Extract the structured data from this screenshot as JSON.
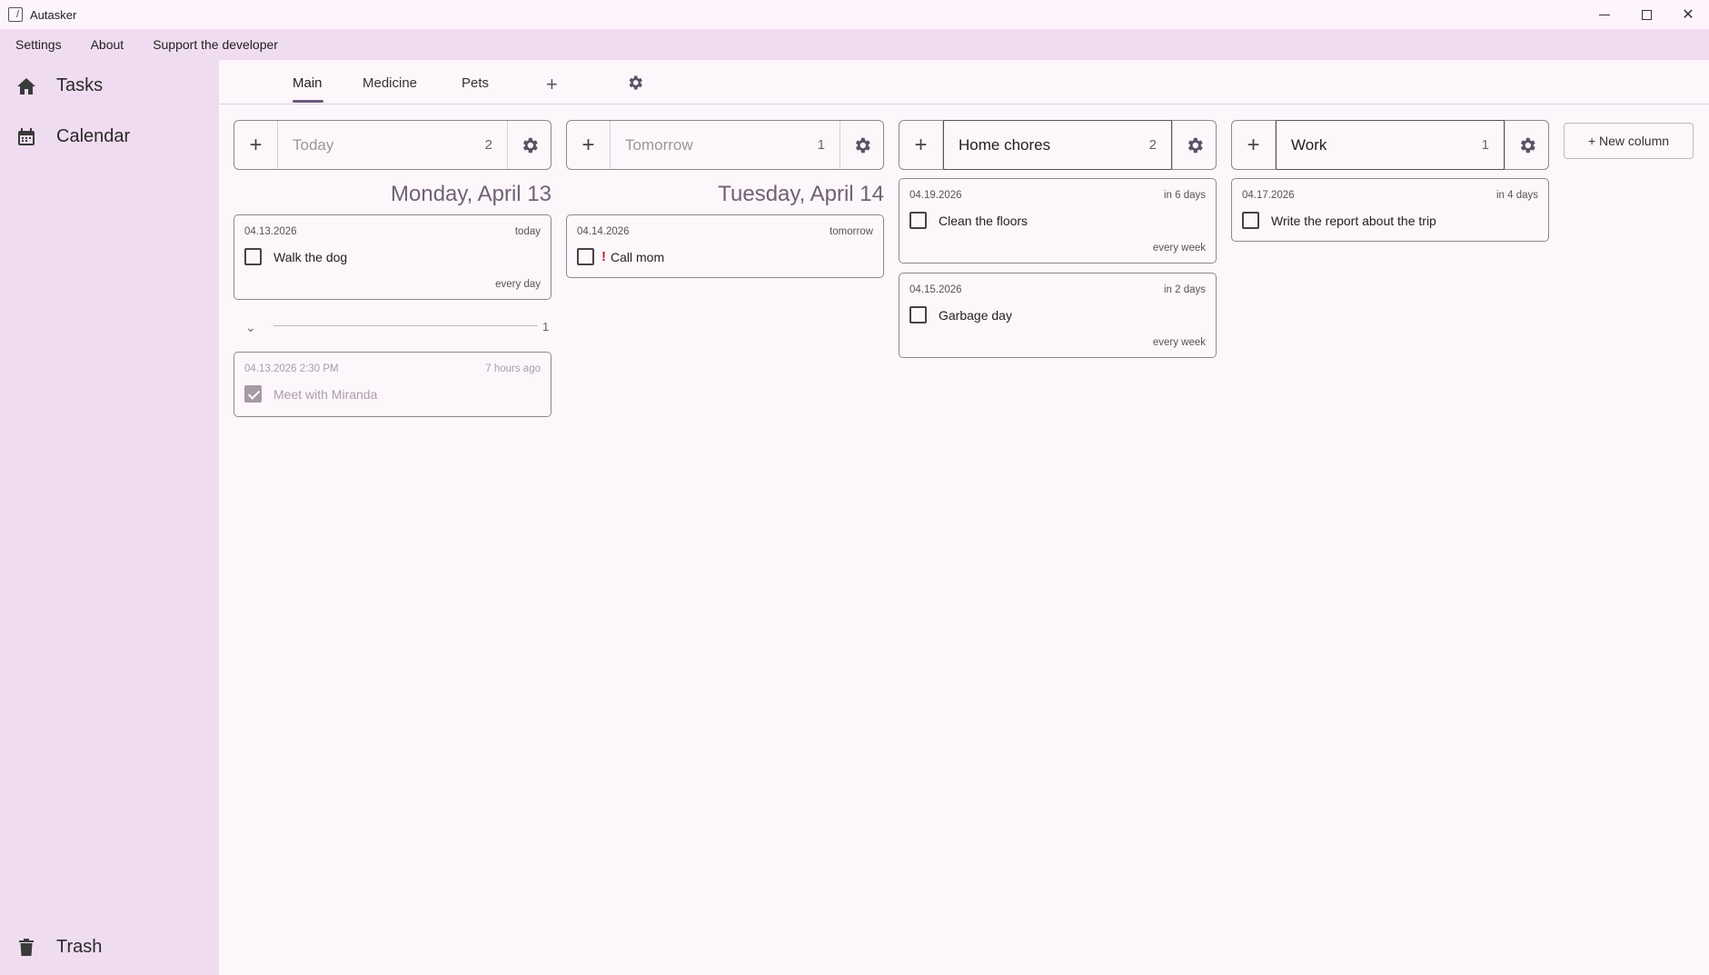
{
  "window": {
    "title": "Autasker"
  },
  "menu": {
    "settings": "Settings",
    "about": "About",
    "support": "Support the developer"
  },
  "sidebar": {
    "tasks": "Tasks",
    "calendar": "Calendar",
    "trash": "Trash"
  },
  "tabs": {
    "main": "Main",
    "medicine": "Medicine",
    "pets": "Pets"
  },
  "columns": {
    "today": {
      "name": "Today",
      "count": "2",
      "heading": "Monday, April 13"
    },
    "tomorrow": {
      "name": "Tomorrow",
      "count": "1",
      "heading": "Tuesday, April 14"
    },
    "home": {
      "name": "Home chores",
      "count": "2"
    },
    "work": {
      "name": "Work",
      "count": "1"
    }
  },
  "tasks": {
    "walk": {
      "date": "04.13.2026",
      "rel": "today",
      "title": "Walk the dog",
      "repeat": "every day"
    },
    "miranda": {
      "date": "04.13.2026 2:30 PM",
      "rel": "7 hours ago",
      "title": "Meet with Miranda"
    },
    "mom": {
      "date": "04.14.2026",
      "rel": "tomorrow",
      "title": "Call mom",
      "priority": "!"
    },
    "floors": {
      "date": "04.19.2026",
      "rel": "in 6 days",
      "title": "Clean the floors",
      "repeat": "every week"
    },
    "garbage": {
      "date": "04.15.2026",
      "rel": "in 2 days",
      "title": "Garbage day",
      "repeat": "every week"
    },
    "report": {
      "date": "04.17.2026",
      "rel": "in 4 days",
      "title": "Write the report about the trip"
    }
  },
  "completed_count": "1",
  "new_column": "+ New column",
  "colors": {
    "sidebar": "#f0dcf1",
    "background": "#fdf6fb",
    "accent": "#6b5b7b",
    "priority": "#c0202a"
  }
}
